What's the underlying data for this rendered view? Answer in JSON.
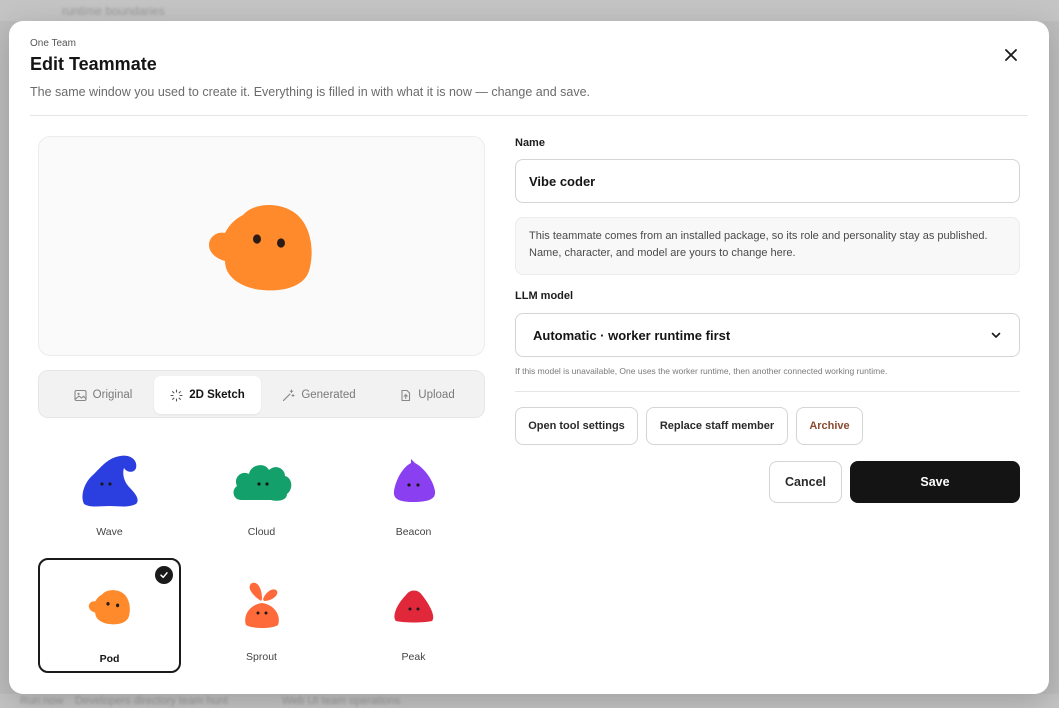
{
  "background": {
    "top_text": "runtime boundaries",
    "bottom_texts": [
      "Run now",
      "Developers directory team hunt",
      "Web UI team operations"
    ]
  },
  "modal": {
    "eyebrow": "One Team",
    "title": "Edit Teammate",
    "subtitle": "The same window you used to create it. Everything is filled in with what it is now — change and save."
  },
  "avatar_tabs": [
    {
      "label": "Original",
      "icon": "image-icon",
      "active": false
    },
    {
      "label": "2D Sketch",
      "icon": "sparkle-icon",
      "active": true
    },
    {
      "label": "Generated",
      "icon": "magic-wand-icon",
      "active": false
    },
    {
      "label": "Upload",
      "icon": "upload-icon",
      "active": false
    }
  ],
  "characters": [
    {
      "label": "Wave",
      "color": "#2b3fe0",
      "selected": false
    },
    {
      "label": "Cloud",
      "color": "#14a06a",
      "selected": false
    },
    {
      "label": "Beacon",
      "color": "#8a3ff0",
      "selected": false
    },
    {
      "label": "Pod",
      "color": "#ff8a2b",
      "selected": true
    },
    {
      "label": "Sprout",
      "color": "#ff6a3a",
      "selected": false
    },
    {
      "label": "Peak",
      "color": "#e0283a",
      "selected": false
    }
  ],
  "form": {
    "name_label": "Name",
    "name_value": "Vibe coder",
    "info_text": "This teammate comes from an installed package, so its role and personality stay as published. Name, character, and model are yours to change here.",
    "model_label": "LLM model",
    "model_value": "Automatic · worker runtime first",
    "model_hint": "If this model is unavailable, One uses the worker runtime, then another connected working runtime."
  },
  "actions": {
    "open_tool_settings": "Open tool settings",
    "replace_staff": "Replace staff member",
    "archive": "Archive",
    "cancel": "Cancel",
    "save": "Save"
  },
  "colors": {
    "accent_dark": "#141414",
    "archive_text": "#8a4a30",
    "pod_orange": "#ff8a2b"
  }
}
